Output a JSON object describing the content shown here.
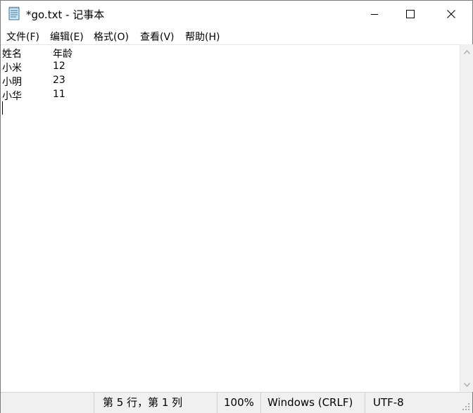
{
  "window": {
    "title": "*go.txt - 记事本",
    "icon": "notepad-icon",
    "controls": [
      "minimize-icon",
      "maximize-icon",
      "close-icon"
    ]
  },
  "menu": {
    "items": [
      "文件(F)",
      "编辑(E)",
      "格式(O)",
      "查看(V)",
      "帮助(H)"
    ]
  },
  "editor": {
    "lines": [
      {
        "col1": "姓名",
        "col2": "年龄"
      },
      {
        "col1": "小米",
        "col2": "12"
      },
      {
        "col1": "小明",
        "col2": "23"
      },
      {
        "col1": "小华",
        "col2": "11"
      }
    ]
  },
  "status": {
    "position": "第 5 行，第 1 列",
    "zoom": "100%",
    "line_ending": "Windows (CRLF)",
    "encoding": "UTF-8"
  }
}
